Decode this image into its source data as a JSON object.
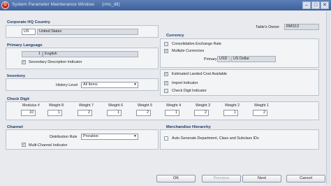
{
  "window": {
    "title": "System Parameter Maintenance Window",
    "subtitle": "(rms_dtl)",
    "app_icon_glyph": "O",
    "minimize_glyph": "–",
    "maximize_glyph": "□",
    "close_glyph": "✕"
  },
  "table_owner": {
    "label": "Table's Owner",
    "value": "RMS13"
  },
  "corporate_hq": {
    "title": "Corporate HQ Country",
    "code": "US",
    "name": "United States"
  },
  "currency": {
    "title": "Currency",
    "consolidation_label": "Consolidation Exchange Rate",
    "multiple_label": "Multiple Currencies",
    "primary_label": "Primary",
    "primary_code": "USD",
    "primary_name": "US Dollar"
  },
  "primary_language": {
    "title": "Primary Language",
    "code": "1",
    "name": "English",
    "secondary_label": "Secondary Description Indicator"
  },
  "inventory": {
    "title": "Inventory",
    "history_label": "History Level",
    "history_value": "All Items"
  },
  "flags": {
    "landed_cost_label": "Estimated Landed Cost Available",
    "import_label": "Import Indicator",
    "check_digit_label": "Check Digit Indicator"
  },
  "check_digit": {
    "title": "Check Digit",
    "fields": [
      {
        "label": "Modulus #",
        "value": "10"
      },
      {
        "label": "Weight 8",
        "value": "1"
      },
      {
        "label": "Weight 7",
        "value": "2"
      },
      {
        "label": "Weight 6",
        "value": "1"
      },
      {
        "label": "Weight 5",
        "value": "2"
      },
      {
        "label": "Weight 4",
        "value": "1"
      },
      {
        "label": "Weight 3",
        "value": "2"
      },
      {
        "label": "Weight 2",
        "value": "1"
      },
      {
        "label": "Weight 1",
        "value": "2"
      }
    ]
  },
  "channel": {
    "title": "Channel",
    "distribution_label": "Distribution Rule",
    "distribution_value": "Proration",
    "multi_channel_label": "Multi-Channel Indicator"
  },
  "merch_hierarchy": {
    "title": "Merchandise Hierarchy",
    "auto_gen_label": "Auto Generate Department, Class and Subclass IDs"
  },
  "buttons": {
    "ok": "OK",
    "previous": "Previous",
    "next": "Next",
    "cancel": "Cancel"
  },
  "glyphs": {
    "check": "✓",
    "dropdown": "▼"
  }
}
